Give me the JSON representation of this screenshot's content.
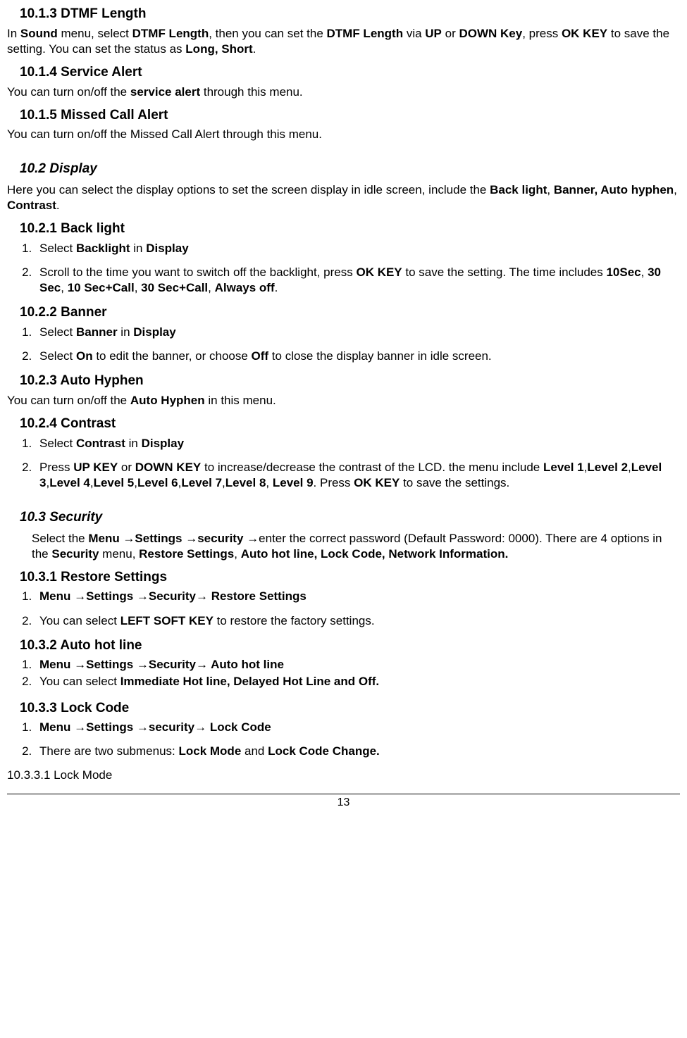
{
  "s1": {
    "title": "10.1.3 DTMF Length",
    "p_a": "In ",
    "p_b": "Sound",
    "p_c": " menu, select ",
    "p_d": "DTMF Length",
    "p_e": ", then you can set the ",
    "p_f": "DTMF Length",
    "p_g": " via ",
    "p_h": "UP",
    "p_i": " or ",
    "p_j": "DOWN Key",
    "p_k": ", press ",
    "p_l": "OK KEY",
    "p_m": " to save the setting. You can set the status as ",
    "p_n": "Long, Short",
    "p_o": "."
  },
  "s2": {
    "title": "10.1.4 Service Alert",
    "p_a": "You can turn on/off the ",
    "p_b": "service alert",
    "p_c": " through this menu."
  },
  "s3": {
    "title": "10.1.5 Missed Call Alert",
    "p": "You can turn on/off the Missed Call Alert through this menu."
  },
  "s4": {
    "title": "10.2  Display",
    "p_a": "Here you can select the display options to set the screen display in idle screen, include the ",
    "p_b": "Back light",
    "p_c": ", ",
    "p_d": "Banner, Auto hyphen",
    "p_e": ", ",
    "p_f": "Contrast",
    "p_g": "."
  },
  "s5": {
    "title": "10.2.1 Back light",
    "li1_a": "Select ",
    "li1_b": "Backlight",
    "li1_c": " in ",
    "li1_d": "Display",
    "li2_a": "Scroll to the time you want to switch off the backlight, press ",
    "li2_b": "OK KEY",
    "li2_c": " to save the setting. The time includes ",
    "li2_d": "10Sec",
    "li2_e": ", ",
    "li2_f": "30 Sec",
    "li2_g": ", ",
    "li2_h": "10 Sec+Call",
    "li2_i": ", ",
    "li2_j": "30 Sec+Call",
    "li2_k": ", ",
    "li2_l": "Always off",
    "li2_m": "."
  },
  "s6": {
    "title": "10.2.2 Banner",
    "li1_a": "Select ",
    "li1_b": "Banner",
    "li1_c": " in ",
    "li1_d": "Display",
    "li2_a": "Select ",
    "li2_b": "On",
    "li2_c": " to edit the banner, or choose ",
    "li2_d": "Off",
    "li2_e": " to close the display banner in idle screen."
  },
  "s7": {
    "title": "10.2.3 Auto Hyphen",
    "p_a": "You can turn on/off the ",
    "p_b": "Auto Hyphen",
    "p_c": " in this menu."
  },
  "s8": {
    "title": "10.2.4 Contrast",
    "li1_a": "Select ",
    "li1_b": "Contrast",
    "li1_c": " in ",
    "li1_d": "Display",
    "li2_a": "Press ",
    "li2_b": "UP KEY",
    "li2_c": " or ",
    "li2_d": "DOWN KEY",
    "li2_e": " to increase/decrease the contrast of the LCD. the  menu include ",
    "li2_f": "Level 1",
    "li2_g": ",",
    "li2_h": "Level 2",
    "li2_i": ",",
    "li2_j": "Level 3",
    "li2_k": ",",
    "li2_l": "Level 4",
    "li2_m": ",",
    "li2_n": "Level 5",
    "li2_o": ",",
    "li2_p": "Level 6",
    "li2_q": ",",
    "li2_r": "Level 7",
    "li2_s": ",",
    "li2_t": "Level 8",
    "li2_u": ", ",
    "li2_v": "Level 9",
    "li2_w": ". Press ",
    "li2_x": "OK KEY",
    "li2_y": " to save the settings."
  },
  "s9": {
    "title": "10.3  Security",
    "p_a": "Select the ",
    "p_b": "Menu →Settings →security →",
    "p_c": "enter the correct password (Default Password: 0000). There are 4 options in the ",
    "p_d": "Security",
    "p_e": " menu, ",
    "p_f": "Restore Settings",
    "p_g": ", ",
    "p_h": "Auto hot line, Lock Code, Network Information."
  },
  "s10": {
    "title": "10.3.1 Restore Settings",
    "li1": "Menu →Settings →Security→ Restore Settings",
    "li2_a": "You can select ",
    "li2_b": "LEFT SOFT KEY",
    "li2_c": " to restore the factory settings."
  },
  "s11": {
    "title": "10.3.2 Auto hot line",
    "li1": "Menu →Settings →Security→ Auto hot line",
    "li2_a": "You can select ",
    "li2_b": "Immediate Hot line, Delayed Hot Line and Off."
  },
  "s12": {
    "title": "10.3.3 Lock Code",
    "li1": "Menu →Settings →security→ Lock Code",
    "li2_a": "There are two submenus: ",
    "li2_b": "Lock Mode",
    "li2_c": " and ",
    "li2_d": "Lock Code Change.",
    "sub": "10.3.3.1  Lock Mode"
  },
  "footer": "13"
}
